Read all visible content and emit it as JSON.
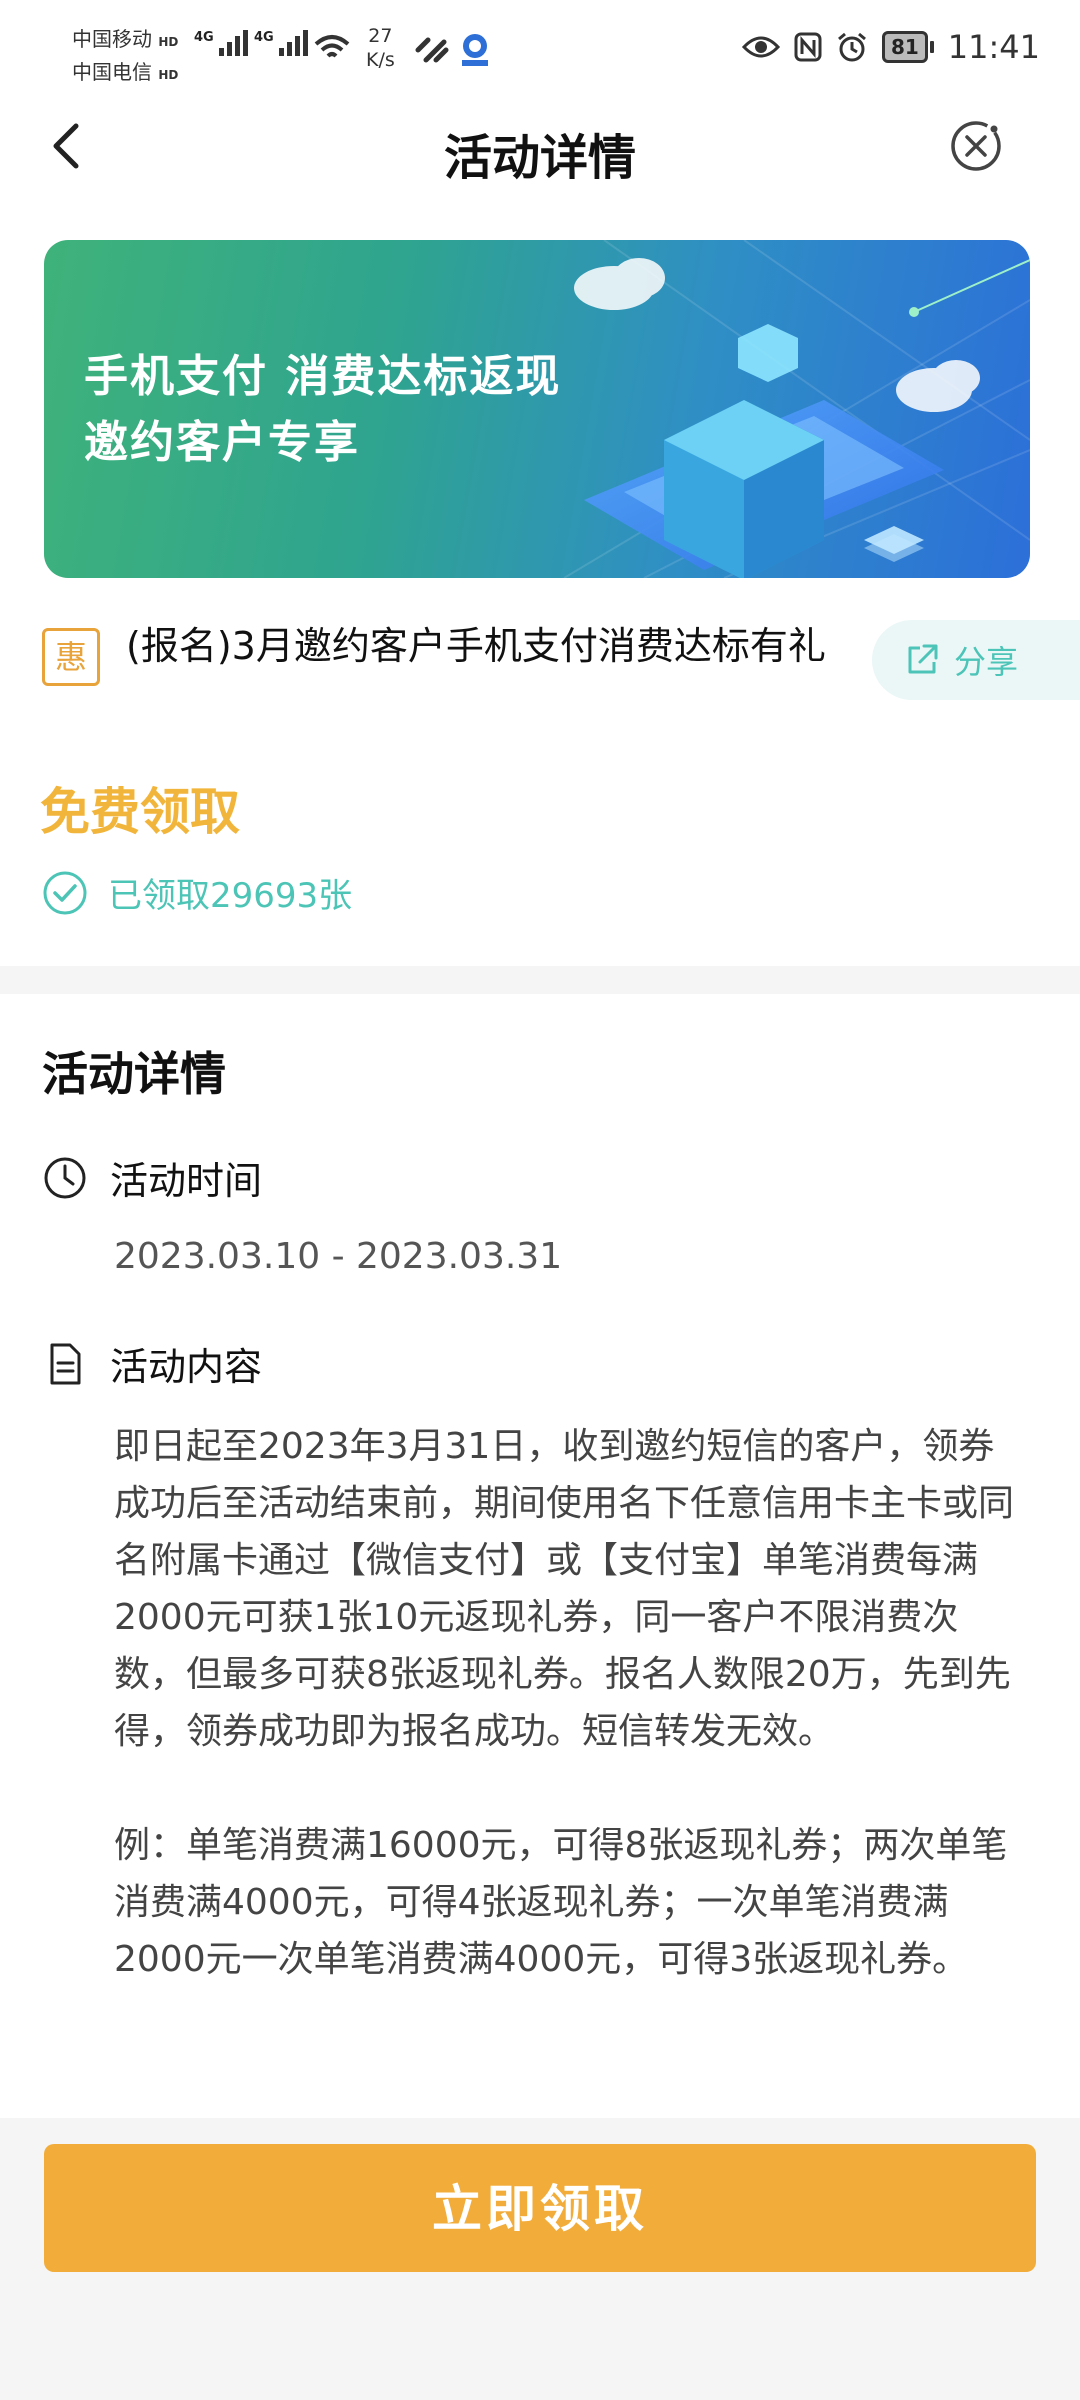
{
  "status_bar": {
    "carrier_1": "中国移动",
    "carrier_2": "中国电信",
    "hd_badge": "HD",
    "network_1": "4G",
    "network_2": "4G",
    "net_speed_value": "27",
    "net_speed_unit": "K/s",
    "battery": "81",
    "time": "11:41",
    "icons": [
      "signal-icon",
      "wifi-icon",
      "link-icon",
      "app-icon",
      "eye-icon",
      "nfc-icon",
      "alarm-icon",
      "battery-icon"
    ]
  },
  "nav": {
    "title": "活动详情",
    "back_icon": "chevron-left-icon",
    "close_icon": "close-circle-icon"
  },
  "banner": {
    "line1": "手机支付 消费达标返现",
    "line2": "邀约客户专享",
    "colors": {
      "start": "#3fb27a",
      "end": "#2c6fd9"
    }
  },
  "activity": {
    "badge": "惠",
    "title": "(报名)3月邀约客户手机支付消费达标有礼",
    "share_label": "分享",
    "price_label": "免费领取",
    "claimed_text": "已领取29693张"
  },
  "details": {
    "section_title": "活动详情",
    "time_label": "活动时间",
    "time_value": "2023.03.10 - 2023.03.31",
    "content_label": "活动内容",
    "content_p1": "即日起至2023年3月31日，收到邀约短信的客户，领券成功后至活动结束前，期间使用名下任意信用卡主卡或同名附属卡通过【微信支付】或【支付宝】单笔消费每满2000元可获1张10元返现礼券，同一客户不限消费次数，但最多可获8张返现礼券。报名人数限20万，先到先得，领券成功即为报名成功。短信转发无效。",
    "content_p2": "例：单笔消费满16000元，可得8张返现礼券；两次单笔消费满4000元，可得4张返现礼券；一次单笔消费满2000元一次单笔消费满4000元，可得3张返现礼券。"
  },
  "footer": {
    "claim_button": "立即领取"
  },
  "colors": {
    "accent_orange": "#f2ac3a",
    "price_yellow": "#f2b53c",
    "teal": "#4cc4b6",
    "badge_orange": "#e8a33a"
  }
}
